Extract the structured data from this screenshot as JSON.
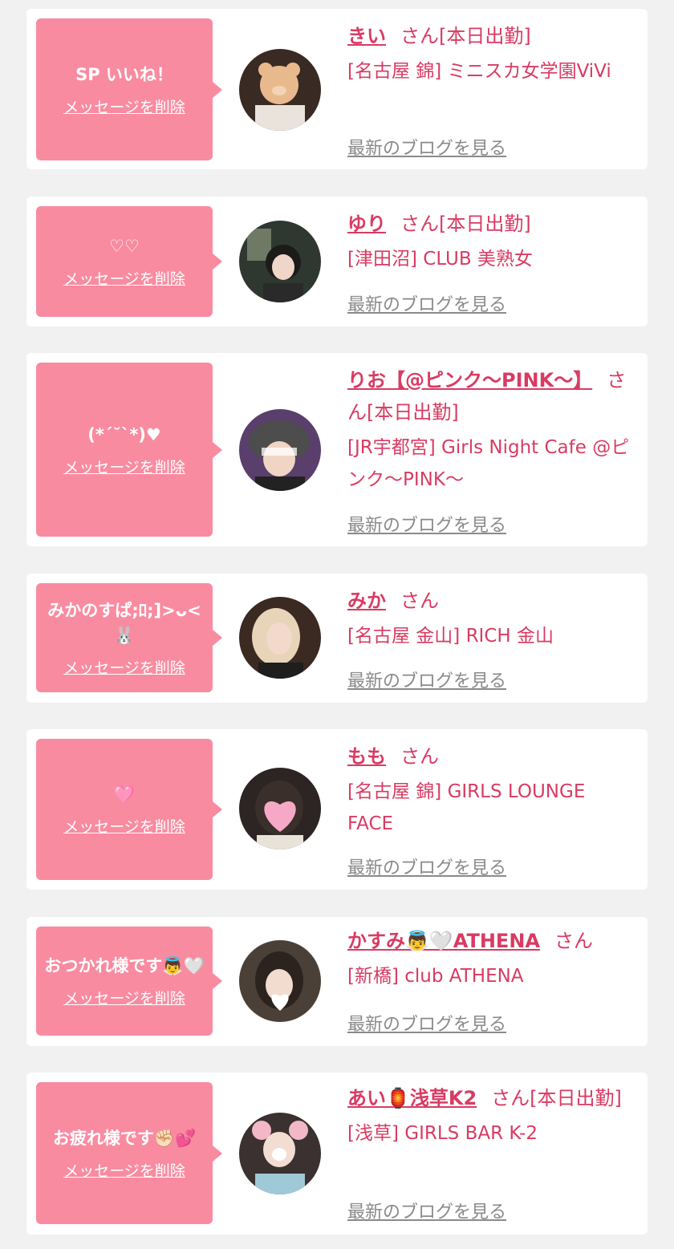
{
  "delete_label": "メッセージを削除",
  "blog_label": "最新のブログを見る",
  "items": [
    {
      "message": "SP いいね！",
      "name": "きい",
      "suffix": "さん[本日出勤]",
      "shop": "[名古屋 錦] ミニスカ女学園ViVi"
    },
    {
      "message": "♡♡",
      "name": "ゆり",
      "suffix": "さん[本日出勤]",
      "shop": "[津田沼] CLUB 美熟女"
    },
    {
      "message": "(*´˘`*)♥",
      "name": "りお【@ピンク〜PINK〜】",
      "suffix": "さん[本日出勤]",
      "shop": "[JR宇都宮] Girls Night Cafe @ピンク〜PINK〜"
    },
    {
      "message": "みかのすぱ;ﾛ;]>ᴗ<🐰",
      "name": "みか",
      "suffix": "さん",
      "shop": "[名古屋 金山] RICH 金山"
    },
    {
      "message": "🩷",
      "name": "もも",
      "suffix": "さん",
      "shop": "[名古屋 錦] GIRLS LOUNGE FACE"
    },
    {
      "message": "おつかれ様です👼🤍",
      "name": "かすみ👼🤍ATHENA",
      "suffix": "さん",
      "shop": "[新橋] club ATHENA"
    },
    {
      "message": "お疲れ様です✊🏻💕",
      "name": "あい🏮浅草K2",
      "suffix": "さん[本日出勤]",
      "shop": "[浅草] GIRLS BAR K-2"
    }
  ],
  "colors": {
    "background": "#f1f1f1",
    "bubble": "#f98ba0",
    "accent": "#d93b62",
    "blog_link": "#8a8a8a"
  }
}
